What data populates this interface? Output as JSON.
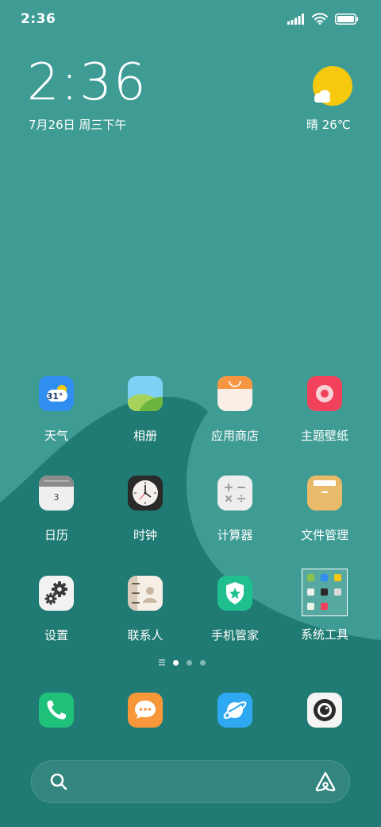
{
  "status_bar": {
    "time": "2:36"
  },
  "clock_widget": {
    "time": "2:36",
    "date": "7月26日 周三下午"
  },
  "weather_widget": {
    "text": "晴 26℃"
  },
  "apps": [
    {
      "label": "天气",
      "icon": "weather-icon",
      "badge": "31°"
    },
    {
      "label": "相册",
      "icon": "gallery-icon"
    },
    {
      "label": "应用商店",
      "icon": "app-store-icon"
    },
    {
      "label": "主题壁纸",
      "icon": "themes-icon"
    },
    {
      "label": "日历",
      "icon": "calendar-icon",
      "badge": "3"
    },
    {
      "label": "时钟",
      "icon": "clock-icon"
    },
    {
      "label": "计算器",
      "icon": "calculator-icon"
    },
    {
      "label": "文件管理",
      "icon": "file-manager-icon"
    },
    {
      "label": "设置",
      "icon": "settings-icon"
    },
    {
      "label": "联系人",
      "icon": "contacts-icon"
    },
    {
      "label": "手机管家",
      "icon": "security-icon"
    },
    {
      "label": "系统工具",
      "icon": "folder-icon"
    }
  ],
  "dock": [
    {
      "icon": "phone-icon"
    },
    {
      "icon": "messages-icon"
    },
    {
      "icon": "browser-icon"
    },
    {
      "icon": "camera-icon"
    }
  ],
  "page_indicator": {
    "pages": 3,
    "current": 1
  },
  "colors": {
    "background": "#3f9c95",
    "wave": "#1f7b73"
  }
}
